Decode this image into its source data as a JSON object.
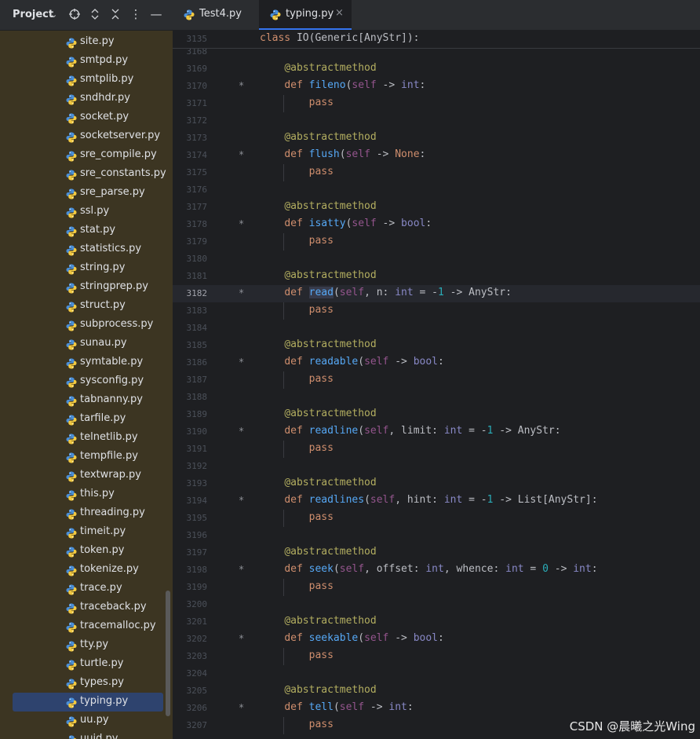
{
  "sidebar": {
    "title": "Project",
    "selected_file": "typing.py",
    "files": [
      "site.py",
      "smtpd.py",
      "smtplib.py",
      "sndhdr.py",
      "socket.py",
      "socketserver.py",
      "sre_compile.py",
      "sre_constants.py",
      "sre_parse.py",
      "ssl.py",
      "stat.py",
      "statistics.py",
      "string.py",
      "stringprep.py",
      "struct.py",
      "subprocess.py",
      "sunau.py",
      "symtable.py",
      "sysconfig.py",
      "tabnanny.py",
      "tarfile.py",
      "telnetlib.py",
      "tempfile.py",
      "textwrap.py",
      "this.py",
      "threading.py",
      "timeit.py",
      "token.py",
      "tokenize.py",
      "trace.py",
      "traceback.py",
      "tracemalloc.py",
      "tty.py",
      "turtle.py",
      "types.py",
      "typing.py",
      "uu.py",
      "uuid.py"
    ]
  },
  "tabs": [
    {
      "label": "Test4.py",
      "active": false,
      "closable": false
    },
    {
      "label": "typing.py",
      "active": true,
      "closable": true
    }
  ],
  "editor": {
    "sticky_line": {
      "num": "3135",
      "tokens": [
        [
          "kw",
          "class "
        ],
        [
          "",
          "IO(Generic[AnyStr]):"
        ]
      ]
    },
    "current_line": "3182",
    "lines": [
      {
        "num": "3168",
        "tokens": []
      },
      {
        "num": "3169",
        "tokens": [
          [
            "",
            "    "
          ],
          [
            "dec",
            "@abstractmethod"
          ]
        ]
      },
      {
        "num": "3170",
        "mark": "*",
        "tokens": [
          [
            "",
            "    "
          ],
          [
            "kw",
            "def "
          ],
          [
            "fn",
            "fileno"
          ],
          [
            "",
            "("
          ],
          [
            "slf",
            "self"
          ],
          [
            "",
            " -> "
          ],
          [
            "bi",
            "int"
          ],
          [
            "",
            ":"
          ]
        ]
      },
      {
        "num": "3171",
        "tokens": [
          [
            "",
            "        "
          ],
          [
            "kw",
            "pass"
          ]
        ]
      },
      {
        "num": "3172",
        "tokens": []
      },
      {
        "num": "3173",
        "tokens": [
          [
            "",
            "    "
          ],
          [
            "dec",
            "@abstractmethod"
          ]
        ]
      },
      {
        "num": "3174",
        "mark": "*",
        "tokens": [
          [
            "",
            "    "
          ],
          [
            "kw",
            "def "
          ],
          [
            "fn",
            "flush"
          ],
          [
            "",
            "("
          ],
          [
            "slf",
            "self"
          ],
          [
            "",
            " -> "
          ],
          [
            "kw",
            "None"
          ],
          [
            "",
            ":"
          ]
        ]
      },
      {
        "num": "3175",
        "tokens": [
          [
            "",
            "        "
          ],
          [
            "kw",
            "pass"
          ]
        ]
      },
      {
        "num": "3176",
        "tokens": []
      },
      {
        "num": "3177",
        "tokens": [
          [
            "",
            "    "
          ],
          [
            "dec",
            "@abstractmethod"
          ]
        ]
      },
      {
        "num": "3178",
        "mark": "*",
        "tokens": [
          [
            "",
            "    "
          ],
          [
            "kw",
            "def "
          ],
          [
            "fn",
            "isatty"
          ],
          [
            "",
            "("
          ],
          [
            "slf",
            "self"
          ],
          [
            "",
            " -> "
          ],
          [
            "bi",
            "bool"
          ],
          [
            "",
            ":"
          ]
        ]
      },
      {
        "num": "3179",
        "tokens": [
          [
            "",
            "        "
          ],
          [
            "kw",
            "pass"
          ]
        ]
      },
      {
        "num": "3180",
        "tokens": []
      },
      {
        "num": "3181",
        "tokens": [
          [
            "",
            "    "
          ],
          [
            "dec",
            "@abstractmethod"
          ]
        ]
      },
      {
        "num": "3182",
        "mark": "*",
        "tokens": [
          [
            "",
            "    "
          ],
          [
            "kw",
            "def "
          ],
          [
            "fn hl",
            "read"
          ],
          [
            "",
            "("
          ],
          [
            "slf",
            "self"
          ],
          [
            "",
            ", n: "
          ],
          [
            "bi",
            "int"
          ],
          [
            "",
            " = -"
          ],
          [
            "num",
            "1"
          ],
          [
            "",
            " -> AnyStr:"
          ]
        ]
      },
      {
        "num": "3183",
        "tokens": [
          [
            "",
            "        "
          ],
          [
            "kw",
            "pass"
          ]
        ]
      },
      {
        "num": "3184",
        "tokens": []
      },
      {
        "num": "3185",
        "tokens": [
          [
            "",
            "    "
          ],
          [
            "dec",
            "@abstractmethod"
          ]
        ]
      },
      {
        "num": "3186",
        "mark": "*",
        "tokens": [
          [
            "",
            "    "
          ],
          [
            "kw",
            "def "
          ],
          [
            "fn",
            "readable"
          ],
          [
            "",
            "("
          ],
          [
            "slf",
            "self"
          ],
          [
            "",
            " -> "
          ],
          [
            "bi",
            "bool"
          ],
          [
            "",
            ":"
          ]
        ]
      },
      {
        "num": "3187",
        "tokens": [
          [
            "",
            "        "
          ],
          [
            "kw",
            "pass"
          ]
        ]
      },
      {
        "num": "3188",
        "tokens": []
      },
      {
        "num": "3189",
        "tokens": [
          [
            "",
            "    "
          ],
          [
            "dec",
            "@abstractmethod"
          ]
        ]
      },
      {
        "num": "3190",
        "mark": "*",
        "tokens": [
          [
            "",
            "    "
          ],
          [
            "kw",
            "def "
          ],
          [
            "fn",
            "readline"
          ],
          [
            "",
            "("
          ],
          [
            "slf",
            "self"
          ],
          [
            "",
            ", limit: "
          ],
          [
            "bi",
            "int"
          ],
          [
            "",
            " = -"
          ],
          [
            "num",
            "1"
          ],
          [
            "",
            " -> AnyStr:"
          ]
        ]
      },
      {
        "num": "3191",
        "tokens": [
          [
            "",
            "        "
          ],
          [
            "kw",
            "pass"
          ]
        ]
      },
      {
        "num": "3192",
        "tokens": []
      },
      {
        "num": "3193",
        "tokens": [
          [
            "",
            "    "
          ],
          [
            "dec",
            "@abstractmethod"
          ]
        ]
      },
      {
        "num": "3194",
        "mark": "*",
        "tokens": [
          [
            "",
            "    "
          ],
          [
            "kw",
            "def "
          ],
          [
            "fn",
            "readlines"
          ],
          [
            "",
            "("
          ],
          [
            "slf",
            "self"
          ],
          [
            "",
            ", hint: "
          ],
          [
            "bi",
            "int"
          ],
          [
            "",
            " = -"
          ],
          [
            "num",
            "1"
          ],
          [
            "",
            " -> List[AnyStr]:"
          ]
        ]
      },
      {
        "num": "3195",
        "tokens": [
          [
            "",
            "        "
          ],
          [
            "kw",
            "pass"
          ]
        ]
      },
      {
        "num": "3196",
        "tokens": []
      },
      {
        "num": "3197",
        "tokens": [
          [
            "",
            "    "
          ],
          [
            "dec",
            "@abstractmethod"
          ]
        ]
      },
      {
        "num": "3198",
        "mark": "*",
        "tokens": [
          [
            "",
            "    "
          ],
          [
            "kw",
            "def "
          ],
          [
            "fn",
            "seek"
          ],
          [
            "",
            "("
          ],
          [
            "slf",
            "self"
          ],
          [
            "",
            ", offset: "
          ],
          [
            "bi",
            "int"
          ],
          [
            "",
            ", whence: "
          ],
          [
            "bi",
            "int"
          ],
          [
            "",
            " = "
          ],
          [
            "num",
            "0"
          ],
          [
            "",
            " -> "
          ],
          [
            "bi",
            "int"
          ],
          [
            "",
            ":"
          ]
        ]
      },
      {
        "num": "3199",
        "tokens": [
          [
            "",
            "        "
          ],
          [
            "kw",
            "pass"
          ]
        ]
      },
      {
        "num": "3200",
        "tokens": []
      },
      {
        "num": "3201",
        "tokens": [
          [
            "",
            "    "
          ],
          [
            "dec",
            "@abstractmethod"
          ]
        ]
      },
      {
        "num": "3202",
        "mark": "*",
        "tokens": [
          [
            "",
            "    "
          ],
          [
            "kw",
            "def "
          ],
          [
            "fn",
            "seekable"
          ],
          [
            "",
            "("
          ],
          [
            "slf",
            "self"
          ],
          [
            "",
            " -> "
          ],
          [
            "bi",
            "bool"
          ],
          [
            "",
            ":"
          ]
        ]
      },
      {
        "num": "3203",
        "tokens": [
          [
            "",
            "        "
          ],
          [
            "kw",
            "pass"
          ]
        ]
      },
      {
        "num": "3204",
        "tokens": []
      },
      {
        "num": "3205",
        "tokens": [
          [
            "",
            "    "
          ],
          [
            "dec",
            "@abstractmethod"
          ]
        ]
      },
      {
        "num": "3206",
        "mark": "*",
        "tokens": [
          [
            "",
            "    "
          ],
          [
            "kw",
            "def "
          ],
          [
            "fn",
            "tell"
          ],
          [
            "",
            "("
          ],
          [
            "slf",
            "self"
          ],
          [
            "",
            " -> "
          ],
          [
            "bi",
            "int"
          ],
          [
            "",
            ":"
          ]
        ]
      },
      {
        "num": "3207",
        "tokens": [
          [
            "",
            "        "
          ],
          [
            "kw",
            "pass"
          ]
        ]
      }
    ]
  },
  "watermark": "CSDN @晨曦之光Wing",
  "colors": {
    "accent": "#3574f0",
    "selection": "#2e436e",
    "sidebar_bg": "#3c3522",
    "editor_bg": "#1e1f22"
  }
}
